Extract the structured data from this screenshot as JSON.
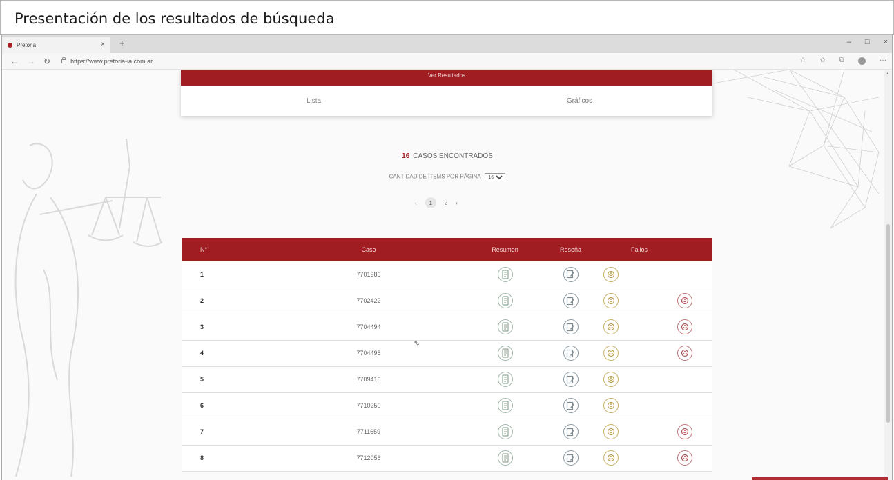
{
  "slide": {
    "title": "Presentación de los resultados de búsqueda"
  },
  "browser": {
    "tab_title": "Pretoria",
    "tab_close": "×",
    "new_tab": "+",
    "url": "https://www.pretoria-ia.com.ar",
    "window_controls": {
      "minimize": "–",
      "maximize": "□",
      "close": "×"
    },
    "nav": {
      "back": "←",
      "forward": "→",
      "reload": "↻"
    }
  },
  "results": {
    "header": "Ver Resultados",
    "tabs": [
      "Lista",
      "Gráficos"
    ]
  },
  "summary": {
    "count": "16",
    "label": "CASOS ENCONTRADOS",
    "per_page_label": "CANTIDAD DE ÍTEMS POR PÁGINA",
    "per_page_value": "16"
  },
  "pager": {
    "prev": "‹",
    "pages": [
      "1",
      "2"
    ],
    "next": "›",
    "current": "1"
  },
  "table": {
    "headers": {
      "num": "N°",
      "caso": "Caso",
      "resumen": "Resumen",
      "resena": "Reseña",
      "fallos": "Fallos"
    },
    "rows": [
      {
        "num": "1",
        "caso": "7701986",
        "fallos": 1
      },
      {
        "num": "2",
        "caso": "7702422",
        "fallos": 2
      },
      {
        "num": "3",
        "caso": "7704494",
        "fallos": 2
      },
      {
        "num": "4",
        "caso": "7704495",
        "fallos": 2
      },
      {
        "num": "5",
        "caso": "7709416",
        "fallos": 1
      },
      {
        "num": "6",
        "caso": "7710250",
        "fallos": 1
      },
      {
        "num": "7",
        "caso": "7711659",
        "fallos": 2
      },
      {
        "num": "8",
        "caso": "7712056",
        "fallos": 2
      }
    ]
  },
  "colors": {
    "brand": "#a01e22",
    "summary_icon": "#9fb6a8",
    "review_icon": "#8d9aa2",
    "ruling_gold": "#c7b165",
    "ruling_red": "#c0767a"
  }
}
